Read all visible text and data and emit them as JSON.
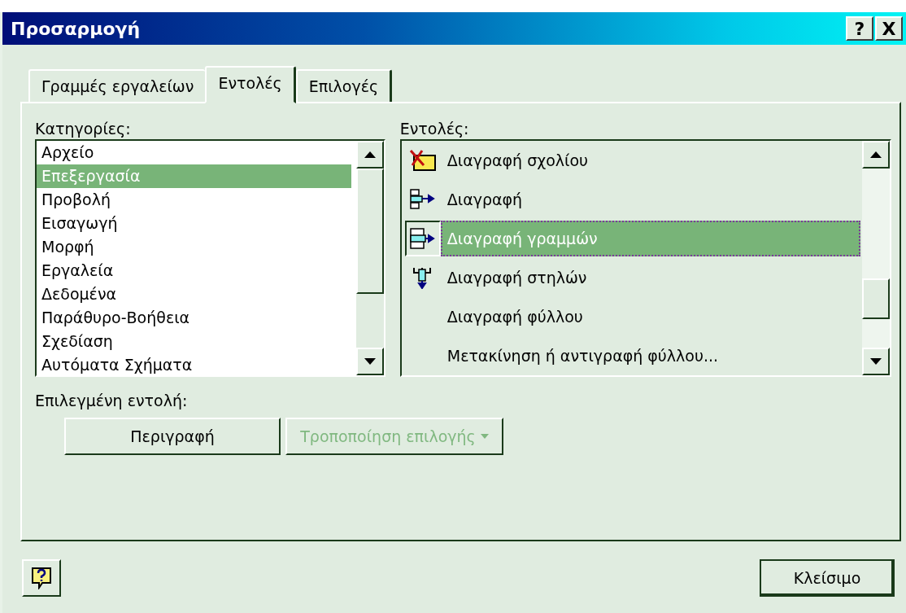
{
  "window": {
    "title": "Προσαρμογή",
    "controls": [
      "?",
      "X"
    ]
  },
  "tabs": [
    {
      "label": "Γραμμές εργαλείων",
      "selected": false
    },
    {
      "label": "Εντολές",
      "selected": true
    },
    {
      "label": "Επιλογές",
      "selected": false
    }
  ],
  "categories": {
    "label": "Κατηγορίες:",
    "items": [
      {
        "label": "Αρχείο",
        "selected": false
      },
      {
        "label": "Επεξεργασία",
        "selected": true
      },
      {
        "label": "Προβολή",
        "selected": false
      },
      {
        "label": "Εισαγωγή",
        "selected": false
      },
      {
        "label": "Μορφή",
        "selected": false
      },
      {
        "label": "Εργαλεία",
        "selected": false
      },
      {
        "label": "Δεδομένα",
        "selected": false
      },
      {
        "label": "Παράθυρο-Βοήθεια",
        "selected": false
      },
      {
        "label": "Σχεδίαση",
        "selected": false
      },
      {
        "label": "Αυτόματα Σχήματα",
        "selected": false
      }
    ]
  },
  "commands": {
    "label": "Εντολές:",
    "items": [
      {
        "label": "Διαγραφή σχολίου",
        "kind": "comment",
        "selected": false
      },
      {
        "label": "Διαγραφή",
        "kind": "cells",
        "selected": false
      },
      {
        "label": "Διαγραφή γραμμών",
        "kind": "rows",
        "selected": true
      },
      {
        "label": "Διαγραφή στηλών",
        "kind": "columns",
        "selected": false
      },
      {
        "label": "Διαγραφή φύλλου",
        "kind": "plain",
        "selected": false
      },
      {
        "label": "Μετακίνηση ή αντιγραφή φύλλου...",
        "kind": "plain",
        "selected": false
      }
    ]
  },
  "selected_command": {
    "label": "Επιλεγμένη εντολή:",
    "description_button": {
      "label": "Περιγραφή",
      "disabled": false
    },
    "modify_button": {
      "label": "Τροποποίηση επιλογής",
      "disabled": true
    }
  },
  "close_button": {
    "label": "Κλείσιμο"
  }
}
